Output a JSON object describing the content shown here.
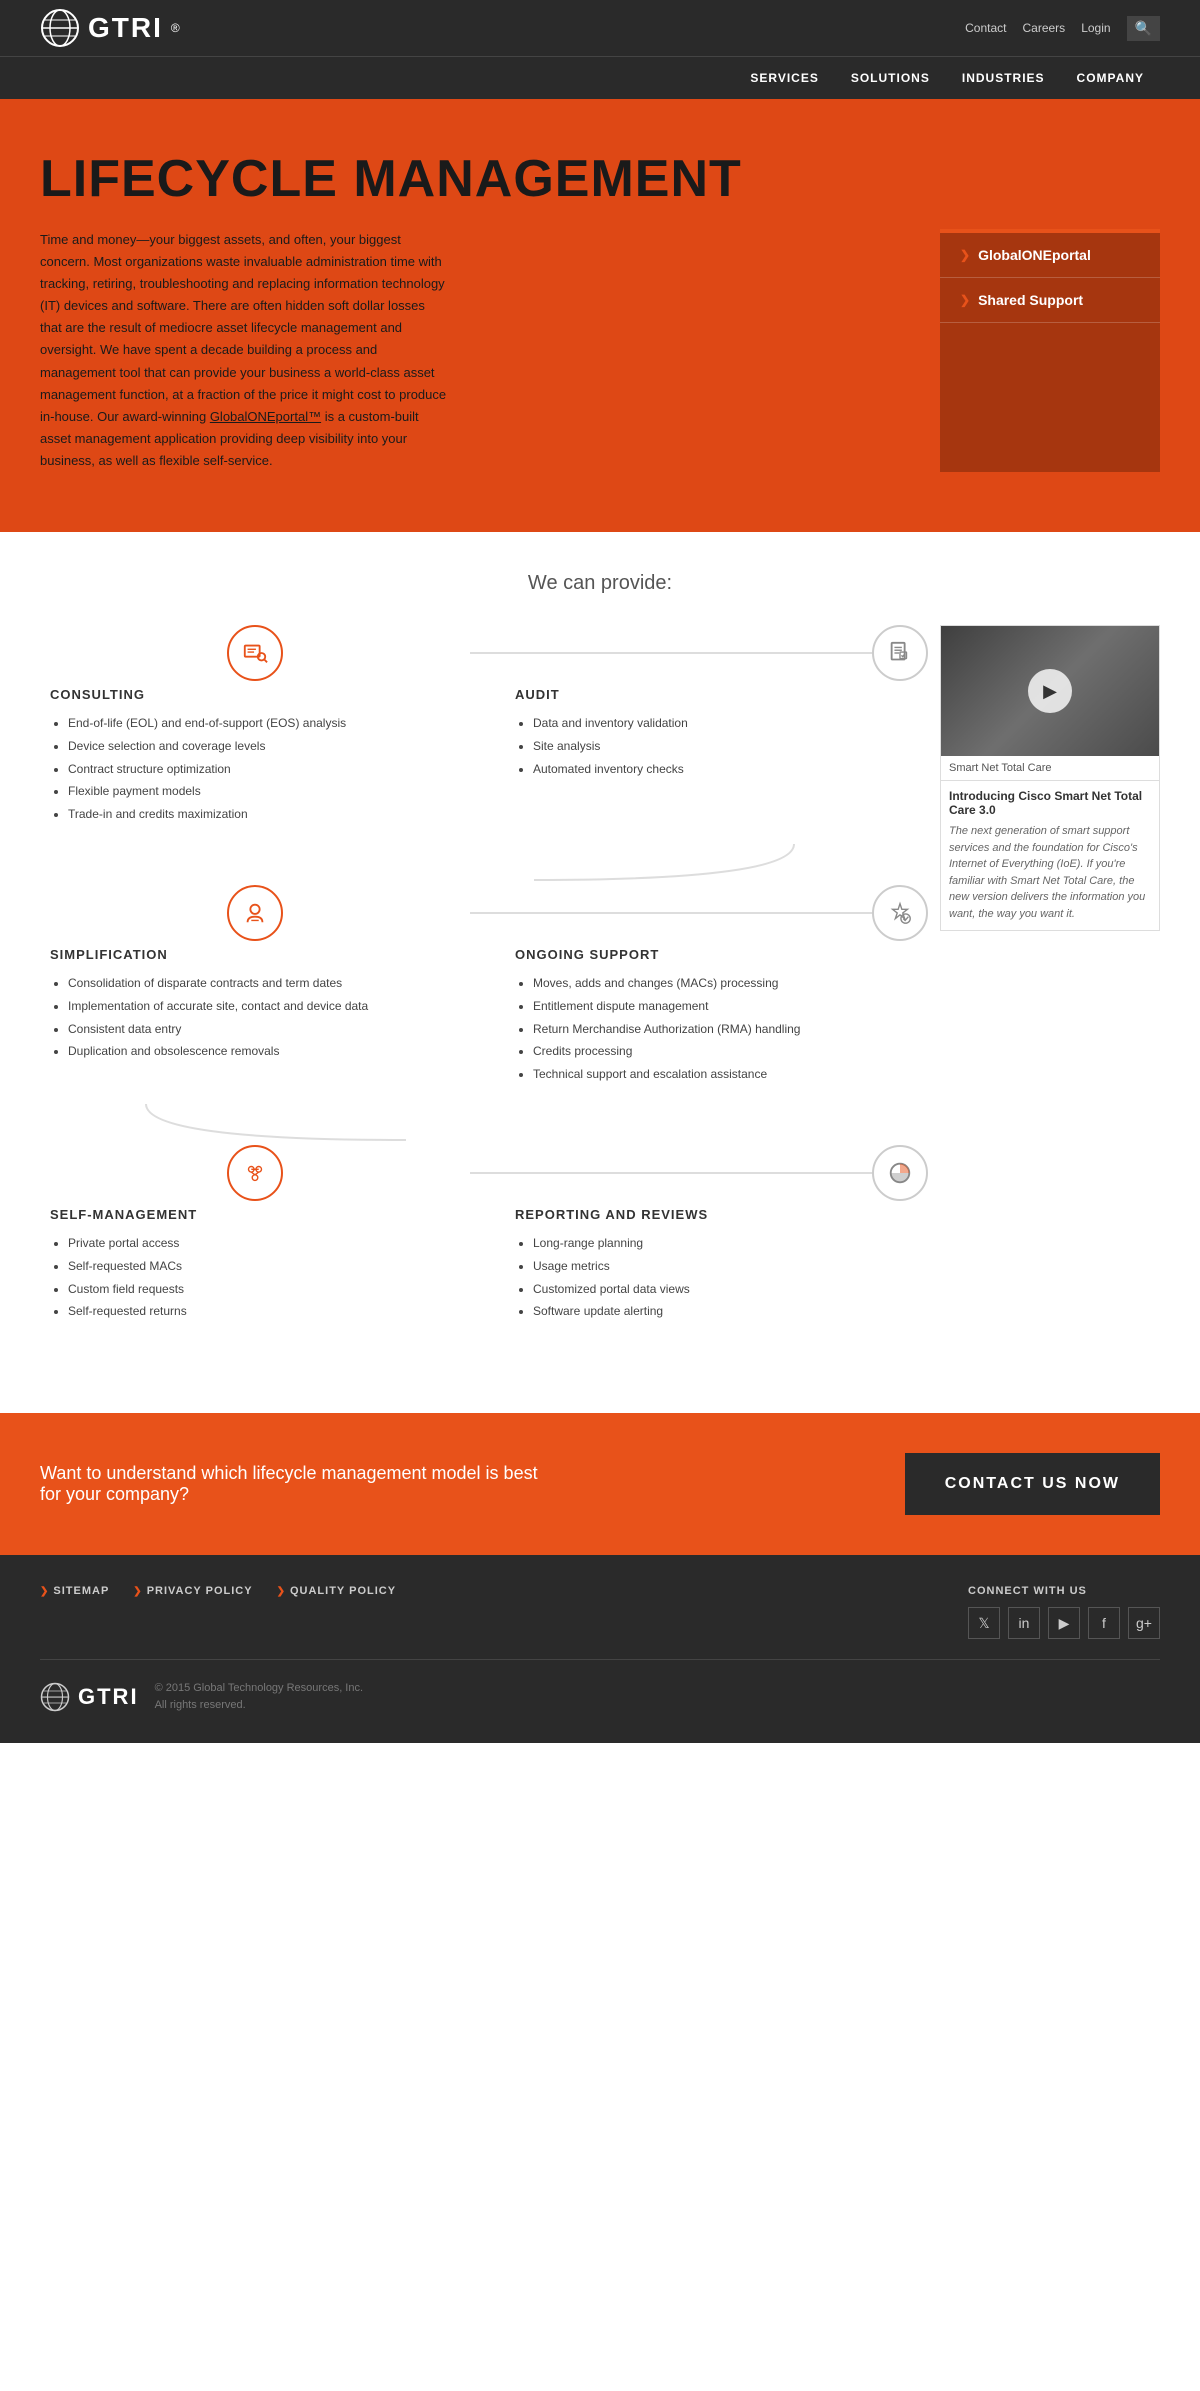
{
  "header": {
    "logo_text": "GTRI",
    "logo_reg": "®",
    "nav_links": [
      {
        "label": "Contact",
        "href": "#"
      },
      {
        "label": "Careers",
        "href": "#"
      },
      {
        "label": "Login",
        "href": "#"
      }
    ],
    "main_nav": [
      {
        "label": "SERVICES"
      },
      {
        "label": "SOLUTIONS"
      },
      {
        "label": "INDUSTRIES"
      },
      {
        "label": "COMPANY"
      }
    ]
  },
  "hero": {
    "title": "LIFECYCLE MANAGEMENT",
    "body": "Time and money—your biggest assets, and often, your biggest concern. Most organizations waste invaluable administration time with tracking, retiring, troubleshooting and replacing information technology (IT) devices and software. There are often hidden soft dollar losses that are the result of mediocre asset lifecycle management and oversight. We have spent a decade building a process and management tool that can provide your business a world-class asset management function, at a fraction of the price it might cost to produce in-house. Our award-winning GlobalONEportal™ is a custom-built asset management application providing deep visibility into your business, as well as flexible self-service.",
    "link_text": "GlobalONEportal™",
    "sidebar_items": [
      "GlobalONEportal",
      "Shared Support"
    ]
  },
  "main": {
    "we_provide": "We can provide:",
    "services": [
      {
        "title": "CONSULTING",
        "items": [
          "End-of-life (EOL) and end-of-support (EOS) analysis",
          "Device selection and coverage levels",
          "Contract structure optimization",
          "Flexible payment models",
          "Trade-in and credits maximization"
        ]
      },
      {
        "title": "AUDIT",
        "items": [
          "Data and inventory validation",
          "Site analysis",
          "Automated inventory checks"
        ]
      },
      {
        "title": "SIMPLIFICATION",
        "items": [
          "Consolidation of disparate contracts and term dates",
          "Implementation of accurate site, contact and device data",
          "Consistent data entry",
          "Duplication and obsolescence removals"
        ]
      },
      {
        "title": "ONGOING SUPPORT",
        "items": [
          "Moves, adds and changes (MACs) processing",
          "Entitlement dispute management",
          "Return Merchandise Authorization (RMA) handling",
          "Credits processing",
          "Technical support and escalation assistance"
        ]
      },
      {
        "title": "SELF-MANAGEMENT",
        "items": [
          "Private portal access",
          "Self-requested MACs",
          "Custom field requests",
          "Self-requested returns"
        ]
      },
      {
        "title": "REPORTING AND REVIEWS",
        "items": [
          "Long-range planning",
          "Usage metrics",
          "Customized portal data views",
          "Software update alerting"
        ]
      }
    ]
  },
  "video": {
    "label": "Smart Net Total Care",
    "title": "Introducing Cisco Smart Net Total Care 3.0",
    "description": "The next generation of smart support services and the foundation for Cisco's Internet of Everything (IoE). If you're familiar with Smart Net Total Care, the new version delivers the information you want, the way you want it."
  },
  "cta": {
    "text": "Want to understand which lifecycle management model is best for your company?",
    "button_label": "CONTACT US NOW"
  },
  "footer": {
    "links": [
      "SITEMAP",
      "PRIVACY POLICY",
      "QUALITY POLICY"
    ],
    "connect_label": "CONNECT WITH US",
    "social": [
      "𝕏",
      "in",
      "▶",
      "f",
      "g+"
    ],
    "copyright": "© 2015 Global Technology Resources, Inc.\nAll rights reserved."
  }
}
